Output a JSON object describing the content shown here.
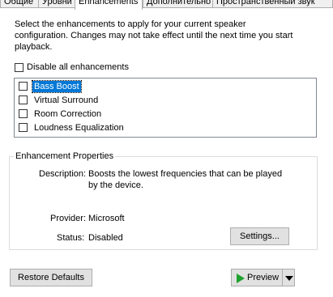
{
  "tabs": [
    "Общие",
    "Уровни",
    "Enhancements",
    "Дополнительно",
    "Пространственный звук"
  ],
  "intro_text": [
    "Select the enhancements to apply for your current speaker",
    "configuration. Changes may not take effect until the next time you start",
    "playback."
  ],
  "disable_all": {
    "label": "Disable all enhancements",
    "checked": false
  },
  "enhancements": [
    {
      "label": "Bass Boost",
      "checked": false,
      "selected": true
    },
    {
      "label": "Virtual Surround",
      "checked": false,
      "selected": false
    },
    {
      "label": "Room Correction",
      "checked": false,
      "selected": false
    },
    {
      "label": "Loudness Equalization",
      "checked": false,
      "selected": false
    }
  ],
  "properties": {
    "title": "Enhancement Properties",
    "description_label": "Description:",
    "description_lines": [
      "Boosts the lowest frequencies that can be played",
      "by the device."
    ],
    "provider_label": "Provider:",
    "provider_value": "Microsoft",
    "status_label": "Status:",
    "status_value": "Disabled",
    "settings_button": "Settings..."
  },
  "footer": {
    "restore_button": "Restore Defaults",
    "preview_button": "Preview"
  },
  "colors": {
    "selection": "#0078d7",
    "play_icon": "#1fa12f"
  }
}
